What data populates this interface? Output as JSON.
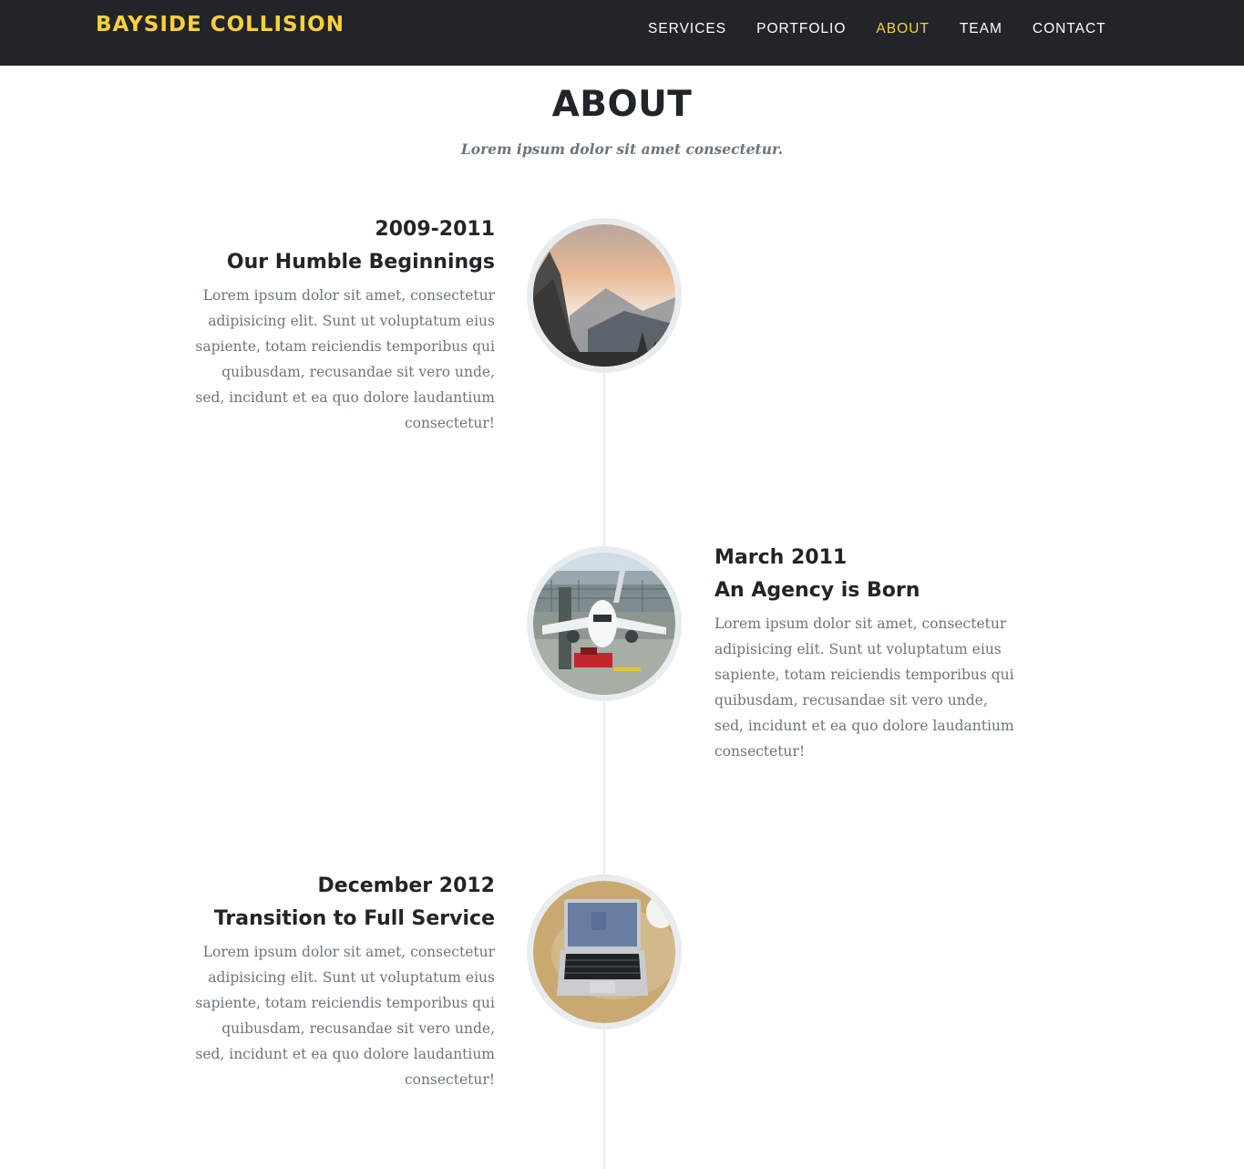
{
  "navbar": {
    "brand": "BAYSIDE COLLISION",
    "links": [
      {
        "label": "SERVICES"
      },
      {
        "label": "PORTFOLIO"
      },
      {
        "label": "ABOUT"
      },
      {
        "label": "TEAM"
      },
      {
        "label": "CONTACT"
      }
    ],
    "active_link": "ABOUT",
    "brand_color": "#fed136",
    "background_color": "#212529"
  },
  "about": {
    "heading": "ABOUT",
    "subheading": "Lorem ipsum dolor sit amet consectetur.",
    "timeline": [
      {
        "date": "2009-2011",
        "title": "Our Humble Beginnings",
        "body": "Lorem ipsum dolor sit amet, consectetur adipisicing elit. Sunt ut voluptatum eius sapiente, totam reiciendis temporibus qui quibusdam, recusandae sit vero unde, sed, incidunt et ea quo dolore laudantium consectetur!",
        "image": "mountain-valley-photo",
        "side": "left"
      },
      {
        "date": "March 2011",
        "title": "An Agency is Born",
        "body": "Lorem ipsum dolor sit amet, consectetur adipisicing elit. Sunt ut voluptatum eius sapiente, totam reiciendis temporibus qui quibusdam, recusandae sit vero unde, sed, incidunt et ea quo dolore laudantium consectetur!",
        "image": "airplane-on-tarmac-photo",
        "side": "right"
      },
      {
        "date": "December 2012",
        "title": "Transition to Full Service",
        "body": "Lorem ipsum dolor sit amet, consectetur adipisicing elit. Sunt ut voluptatum eius sapiente, totam reiciendis temporibus qui quibusdam, recusandae sit vero unde, sed, incidunt et ea quo dolore laudantium consectetur!",
        "image": "laptop-on-desk-photo",
        "side": "left"
      }
    ]
  }
}
